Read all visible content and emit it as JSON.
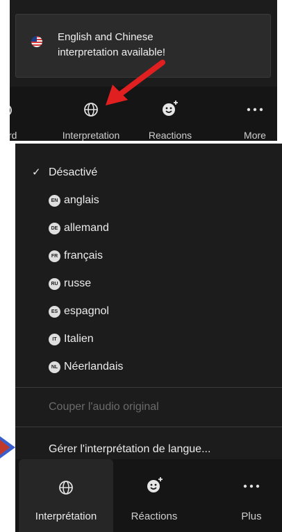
{
  "tooltip": {
    "line1": "English and Chinese",
    "line2": "interpretation available!"
  },
  "toolbar_top": {
    "partial_label": "rd",
    "interpretation": "Interpretation",
    "reactions": "Reactions",
    "more": "More"
  },
  "menu": {
    "items": [
      {
        "label": "Désactivé",
        "checked": true
      },
      {
        "badge": "EN",
        "label": "anglais"
      },
      {
        "badge": "DE",
        "label": "allemand"
      },
      {
        "badge": "FR",
        "label": "français"
      },
      {
        "badge": "RU",
        "label": "russe"
      },
      {
        "badge": "ES",
        "label": "espagnol"
      },
      {
        "badge": "IT",
        "label": "Italien"
      },
      {
        "badge": "NL",
        "label": "Néerlandais"
      }
    ],
    "mute_original": "Couper l'audio original",
    "manage": "Gérer l'interprétation de langue..."
  },
  "toolbar_bottom": {
    "interpretation": "Interprétation",
    "reactions": "Réactions",
    "more": "Plus"
  },
  "colors": {
    "background": "#1c1c1c",
    "toolbar": "#151515",
    "red_arrow": "#e02020",
    "blue_arrow": "#3a5fcd"
  }
}
